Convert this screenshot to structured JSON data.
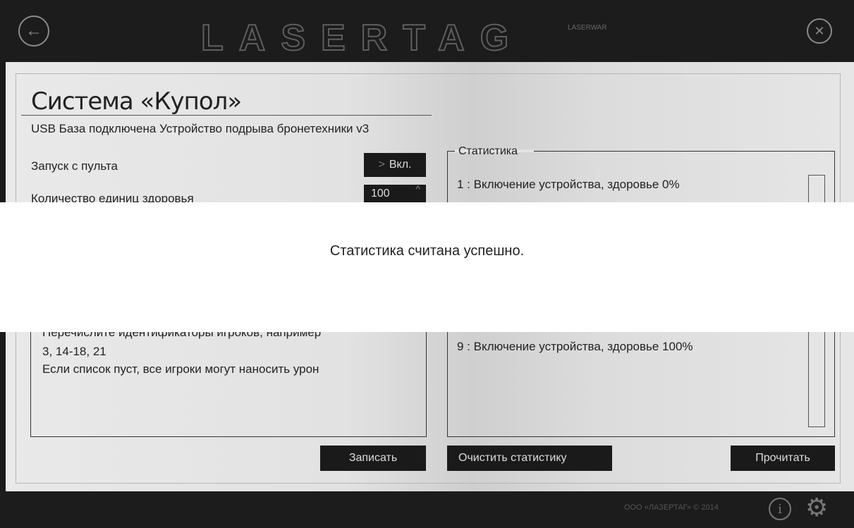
{
  "header": {
    "logo_text": "LASERTAG",
    "logo_sub": "LASERWAR",
    "back_icon": "arrow-left-icon",
    "close_icon": "close-icon"
  },
  "main": {
    "title": "Система «Купол»",
    "subtitle": "USB База подключена Устройство подрыва бронетехники v3",
    "remote_launch_label": "Запуск с пульта",
    "remote_launch_value": "Вкл.",
    "health_label": "Количество единиц здоровья",
    "health_value": "100",
    "player_hint_line1": "Перечислите идентификаторы игроков, например",
    "player_hint_line2": "3, 14-18, 21",
    "player_hint_line3": "Если список пуст, все игроки могут наносить урон",
    "write_button": "Записать"
  },
  "stats": {
    "legend": "Статистика",
    "entries": [
      "1 : Включение устройства, здоровье 0%",
      "9 : Включение устройства, здоровье 100%"
    ],
    "clear_button": "Очистить статистику",
    "read_button": "Прочитать"
  },
  "footer": {
    "copyright": "ООО «ЛАЗЕРТАГ» © 2014",
    "info_icon": "info-icon",
    "settings_icon": "gear-icon"
  },
  "modal": {
    "message": "Статистика считана успешно."
  },
  "colors": {
    "dark_bar": "#1c1c1c",
    "button_bg": "#1a1a1a",
    "content_bg": "#e4e4e4"
  }
}
